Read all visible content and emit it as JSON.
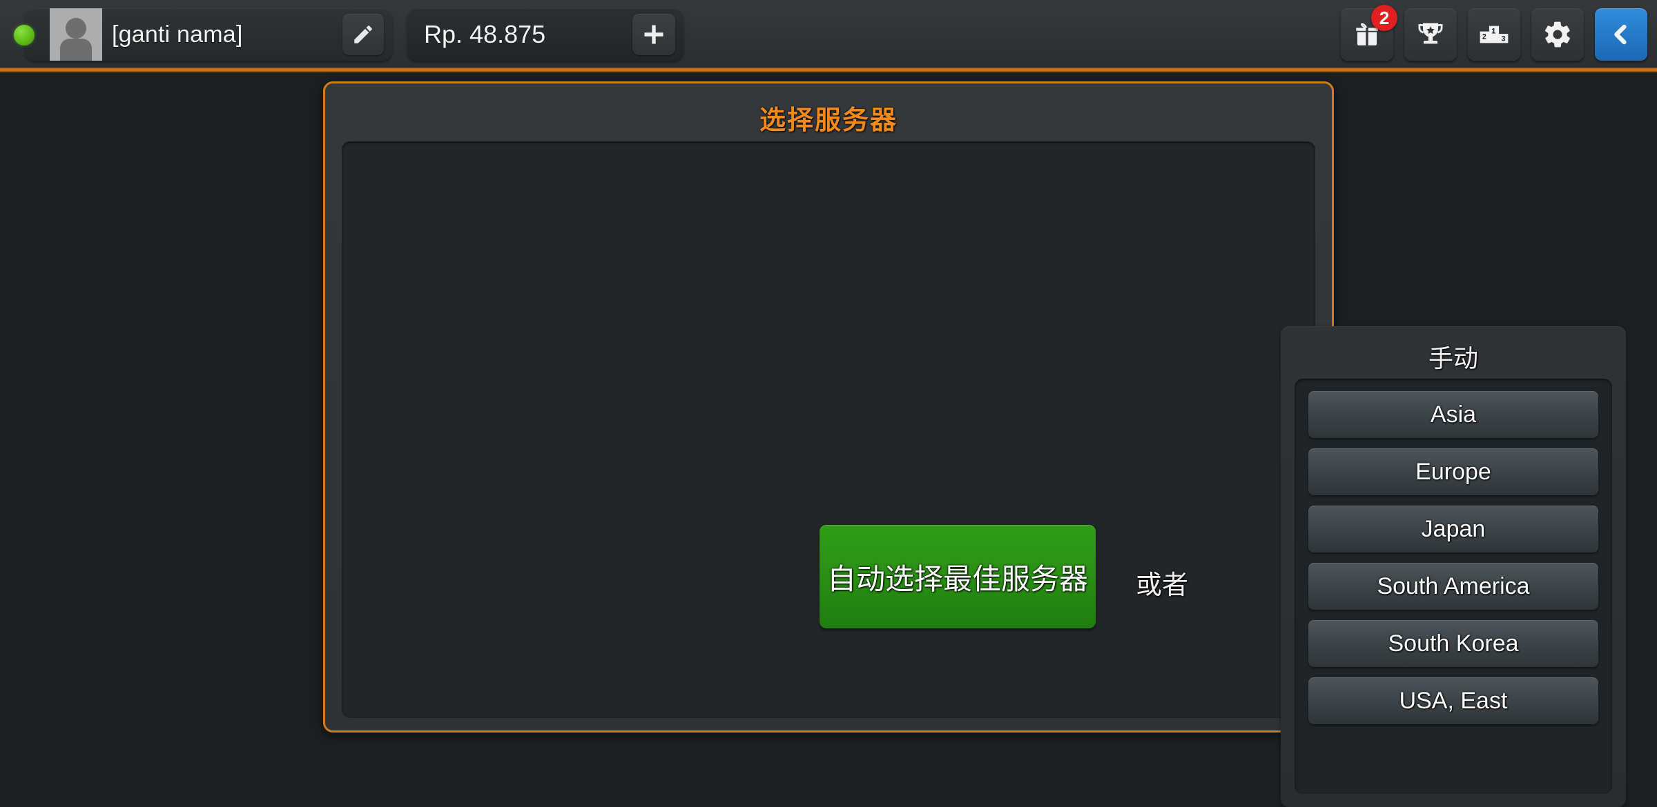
{
  "topbar": {
    "status": {
      "icon": "online-status-dot",
      "state": "online"
    },
    "player": {
      "avatar_icon": "user-avatar-icon",
      "name": "[ganti nama]",
      "edit_icon": "pencil-edit-icon"
    },
    "currency": {
      "amount": "Rp. 48.875",
      "add_icon": "plus-icon"
    },
    "tools": [
      {
        "name": "gift-button",
        "icon": "gift-icon",
        "badge": "2",
        "badge_color": "#e02020"
      },
      {
        "name": "trophy-button",
        "icon": "trophy-icon",
        "badge": null
      },
      {
        "name": "leaderboard-button",
        "icon": "podium-icon",
        "badge": null,
        "podium_labels": [
          "2",
          "1",
          "3"
        ]
      },
      {
        "name": "settings-button",
        "icon": "gear-icon",
        "badge": null
      },
      {
        "name": "back-button",
        "icon": "chevron-left-icon",
        "badge": null,
        "accent": "#2f8ddc"
      }
    ]
  },
  "dialog": {
    "title": "选择服务器",
    "title_color": "#f08a1e",
    "border_color": "#d4791c",
    "auto_button": {
      "label": "自动选择最佳服务器",
      "color": "#2b9115"
    },
    "or_label": "或者",
    "manual": {
      "title": "手动",
      "servers": [
        {
          "label": "Asia"
        },
        {
          "label": "Europe"
        },
        {
          "label": "Japan"
        },
        {
          "label": "South America"
        },
        {
          "label": "South Korea"
        },
        {
          "label": "USA, East"
        }
      ]
    }
  }
}
